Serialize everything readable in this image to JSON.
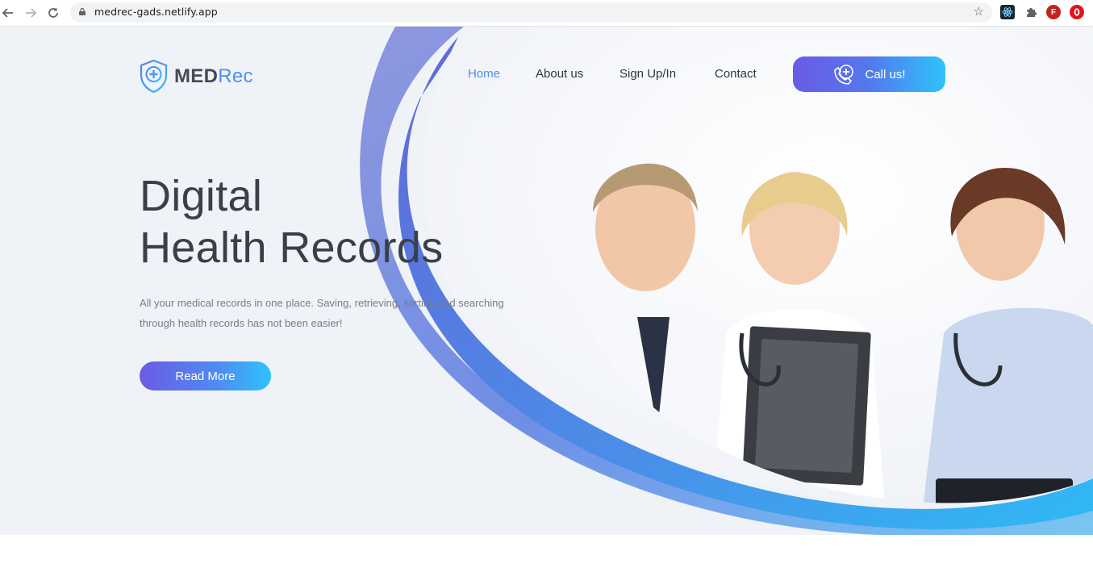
{
  "browser": {
    "url": "medrec-gads.netlify.app",
    "icons": [
      "back-arrow-icon",
      "forward-arrow-icon",
      "reload-icon",
      "lock-icon",
      "bookmark-star-icon",
      "react-devtools-icon",
      "extensions-puzzle-icon",
      "profile-avatar",
      "opera-icon"
    ],
    "profile_initial": "F"
  },
  "site": {
    "logo": {
      "main": "MED",
      "accent": "Rec"
    },
    "nav": {
      "home": "Home",
      "about": "About us",
      "signup": "Sign Up/In",
      "contact": "Contact"
    },
    "call_button": "Call us!",
    "hero": {
      "title_line1": "Digital",
      "title_line2": "Health Records",
      "description": "All your medical records in one place. Saving, retrieving, sorting and searching through health records has not been easier!",
      "cta": "Read More"
    },
    "colors": {
      "accent_blue": "#4a8ef0",
      "gradient_start": "#6a5be5",
      "gradient_end": "#2ec3fb",
      "hero_bg": "#eff3f8"
    }
  }
}
